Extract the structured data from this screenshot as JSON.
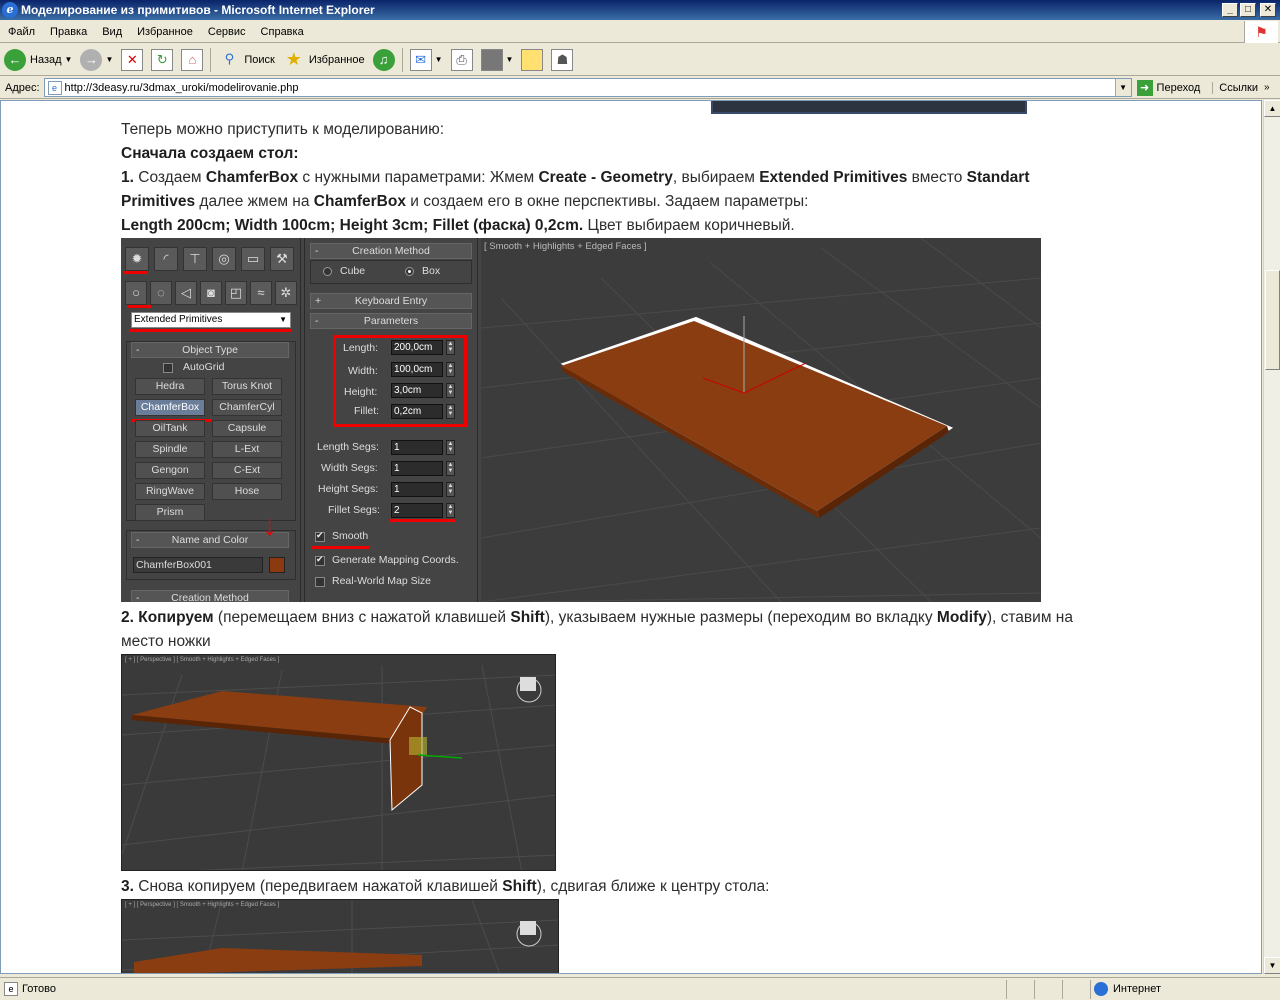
{
  "window": {
    "title": "Моделирование из примитивов - Microsoft Internet Explorer",
    "minimize": "_",
    "maximize": "□",
    "close": "✕"
  },
  "menu": [
    "Файл",
    "Правка",
    "Вид",
    "Избранное",
    "Сервис",
    "Справка"
  ],
  "toolbar": {
    "back": "Назад",
    "search": "Поиск",
    "favorites": "Избранное"
  },
  "address": {
    "label": "Адрес:",
    "url": "http://3deasy.ru/3dmax_uroki/modelirovanie.php",
    "go": "Переход",
    "links": "Ссылки"
  },
  "article": {
    "line1": "Теперь можно приступить к моделированию:",
    "line2": "Сначала создаем стол:",
    "line3_num": "1.",
    "line3_a": " Создаем ",
    "line3_b": "ChamferBox",
    "line3_c": " с нужными параметрами: Жмем ",
    "line3_d": "Create - Geometry",
    "line3_e": ", выбираем ",
    "line3_f": "Extended Primitives",
    "line3_g": " вместо ",
    "line3_h": "Standart",
    "line4_a": "Primitives",
    "line4_b": " далее жмем на ",
    "line4_c": "ChamferBox",
    "line4_d": " и создаем его в окне перспективы. Задаем параметры:",
    "line5_a": "Length 200cm; Width 100cm; Height 3cm; Fillet (фаска) 0,2cm.",
    "line5_b": " Цвет выбираем коричневый.",
    "line6_num": "2.",
    "line6_a": " Копируем",
    "line6_b": " (перемещаем вниз с нажатой клавишей ",
    "line6_c": "Shift",
    "line6_d": "), указываем нужные размеры (переходим во вкладку ",
    "line6_e": "Modify",
    "line6_f": "), ставим на",
    "line7": "место ножки",
    "line8_num": "3.",
    "line8_a": " Снова копируем (передвигаем нажатой клавишей ",
    "line8_b": "Shift",
    "line8_c": "), сдвигая ближе к центру стола:"
  },
  "max_panel": {
    "dropdown": "Extended Primitives",
    "object_type": "Object Type",
    "autogrid": "AutoGrid",
    "buttons": [
      "Hedra",
      "Torus Knot",
      "ChamferBox",
      "ChamferCyl",
      "OilTank",
      "Capsule",
      "Spindle",
      "L-Ext",
      "Gengon",
      "C-Ext",
      "RingWave",
      "Hose",
      "Prism"
    ],
    "name_and_color": "Name and Color",
    "object_name": "ChamferBox001",
    "creation_method_bottom": "Creation Method",
    "creation_method": "Creation Method",
    "cube": "Cube",
    "box": "Box",
    "keyboard_entry": "Keyboard Entry",
    "parameters": "Parameters",
    "length_label": "Length:",
    "length": "200,0cm",
    "width_label": "Width:",
    "width": "100,0cm",
    "height_label": "Height:",
    "height": "3,0cm",
    "fillet_label": "Fillet:",
    "fillet": "0,2cm",
    "length_segs_label": "Length Segs:",
    "length_segs": "1",
    "width_segs_label": "Width Segs:",
    "width_segs": "1",
    "height_segs_label": "Height Segs:",
    "height_segs": "1",
    "fillet_segs_label": "Fillet Segs:",
    "fillet_segs": "2",
    "smooth": "Smooth",
    "gen_mapping": "Generate Mapping Coords.",
    "real_world": "Real-World Map Size",
    "viewport_label": "[ Smooth + Highlights + Edged Faces ]",
    "plus": "+",
    "minus": "-"
  },
  "img2": {
    "label": "[ + ] [ Perspective ] [ Smooth + Highlights + Edged Faces ]"
  },
  "img3": {
    "label": "[ + ] [ Perspective ] [ Smooth + Highlights + Edged Faces ]"
  },
  "status": {
    "text": "Готово",
    "zone": "Интернет"
  }
}
